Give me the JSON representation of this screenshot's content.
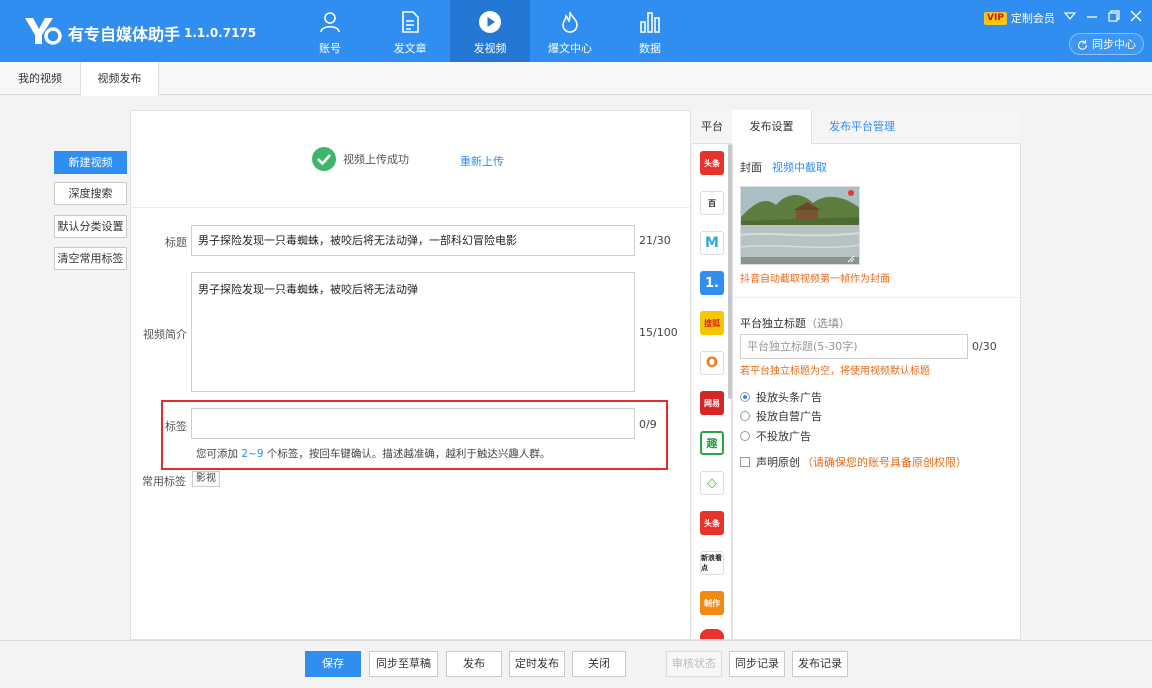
{
  "app": {
    "name": "有专自媒体助手",
    "version": "1.1.0.7175"
  },
  "nav": [
    {
      "label": "账号",
      "icon": "user-icon"
    },
    {
      "label": "发文章",
      "icon": "document-icon"
    },
    {
      "label": "发视频",
      "icon": "play-icon",
      "active": true
    },
    {
      "label": "爆文中心",
      "icon": "fire-icon"
    },
    {
      "label": "数据",
      "icon": "bar-chart-icon"
    }
  ],
  "header": {
    "vip_badge": "VIP",
    "vip_label": "定制会员",
    "sync_center": "同步中心"
  },
  "tabs": [
    "我的视频",
    "视频发布"
  ],
  "sidebar": [
    "新建视频",
    "深度搜索",
    "默认分类设置",
    "清空常用标签"
  ],
  "upload": {
    "status": "视频上传成功",
    "reupload": "重新上传"
  },
  "form": {
    "title_label": "标题",
    "title_value": "男子探险发现一只毒蜘蛛，被咬后将无法动弹，一部科幻冒险电影",
    "title_count": "21/30",
    "desc_label": "视频简介",
    "desc_value": "男子探险发现一只毒蜘蛛，被咬后将无法动弹",
    "desc_count": "15/100",
    "tag_label": "标签",
    "tag_value": "",
    "tag_count": "0/9",
    "tag_hint_pre": "您可添加 ",
    "tag_hint_range": "2~9",
    "tag_hint_post": " 个标签，按回车键确认。描述越准确，越利于触达兴趣人群。",
    "common_tags_label": "常用标签",
    "common_tags": [
      "影视"
    ]
  },
  "platforms": {
    "header": "平台",
    "items": [
      {
        "name": "头条",
        "color": "#e8322d"
      },
      {
        "name": "百",
        "color": "#ffffff"
      },
      {
        "name": "M",
        "color": "#ffffff"
      },
      {
        "name": "1.",
        "color": "#2f8ef0"
      },
      {
        "name": "搜狐",
        "color": "#f7c600"
      },
      {
        "name": "O",
        "color": "#ffffff"
      },
      {
        "name": "网易",
        "color": "#d42626"
      },
      {
        "name": "趣",
        "color": "#ffffff"
      },
      {
        "name": "◇",
        "color": "#ffffff"
      },
      {
        "name": "头条",
        "color": "#e8322d"
      },
      {
        "name": "新浪看点",
        "color": "#ffffff"
      },
      {
        "name": "制作",
        "color": "#f28a12"
      }
    ]
  },
  "settings": {
    "tab_publish": "发布设置",
    "tab_manage": "发布平台管理",
    "cover_label": "封面",
    "cover_link": "视频中截取",
    "cover_note": "抖音自动截取视频第一帧作为封面",
    "ptitle_label": "平台独立标题",
    "ptitle_optional": "（选填）",
    "ptitle_placeholder": "平台独立标题(5-30字)",
    "ptitle_count": "0/30",
    "ptitle_note": "若平台独立标题为空，将使用视频默认标题",
    "ad_options": [
      {
        "label": "投放头条广告",
        "checked": true
      },
      {
        "label": "投放自营广告",
        "checked": false
      },
      {
        "label": "不投放广告",
        "checked": false
      }
    ],
    "original_label": "声明原创",
    "original_warn": "（请确保您的账号具备原创权限）"
  },
  "footer": {
    "save": "保存",
    "sync_draft": "同步至草稿",
    "publish": "发布",
    "schedule": "定时发布",
    "close": "关闭",
    "review_status": "审核状态",
    "sync_log": "同步记录",
    "publish_log": "发布记录"
  }
}
